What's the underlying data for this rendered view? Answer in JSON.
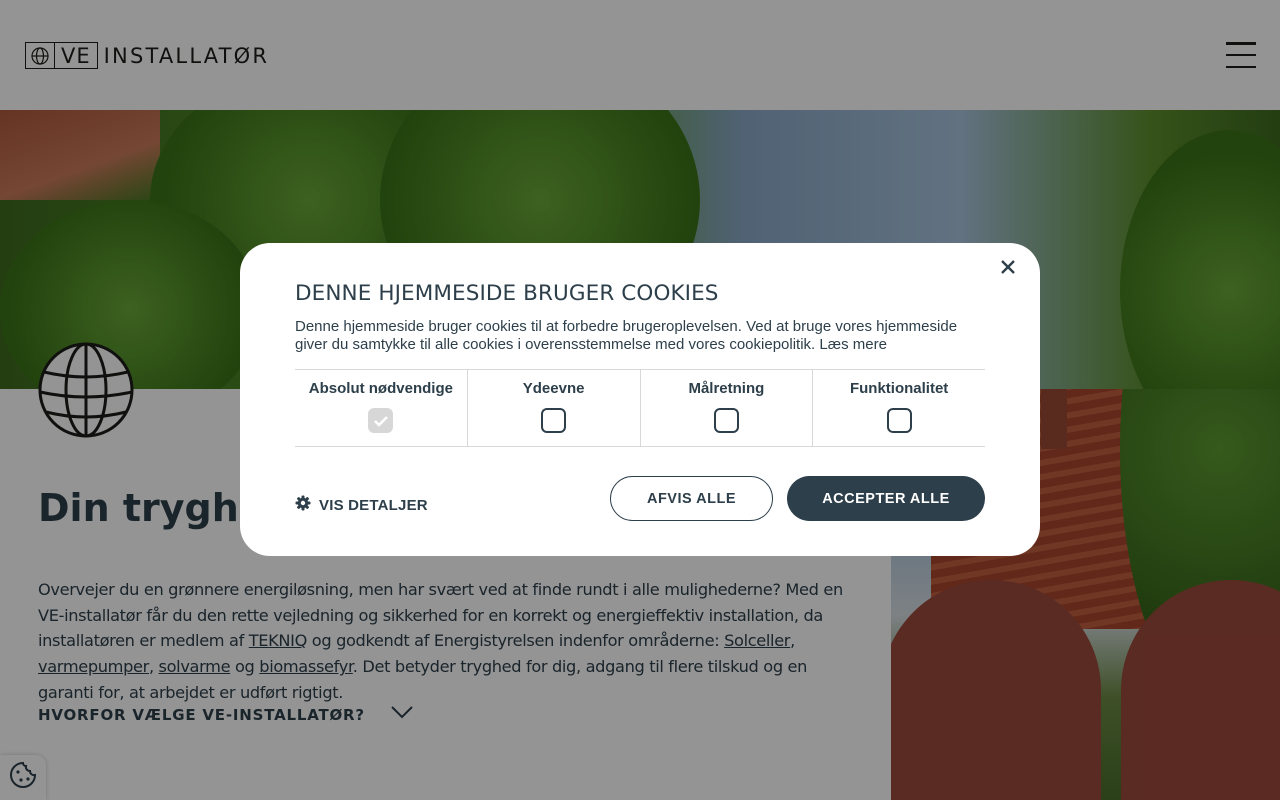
{
  "header": {
    "logo_short": "VE",
    "logo_text": "INSTALLATØR"
  },
  "main": {
    "headline": "Din tryghed",
    "intro_1": "Overvejer du en grønnere energiløsning, men har svært ved at finde rundt i alle mulighederne? Med en VE-installatør får du den rette vejledning og sikkerhed for en korrekt og energieffektiv installation, da installatøren er medlem af ",
    "link_tekniq": "TEKNIQ",
    "intro_2": " og godkendt af Energistyrelsen indenfor områderne: ",
    "link_solceller": "Solceller",
    "sep_1": ", ",
    "link_varmepumper": "varmepumper",
    "sep_2": ", ",
    "link_solvarme": "solvarme",
    "intro_3": " og ",
    "link_biomassefyr": "biomassefyr",
    "intro_4": ". Det betyder tryghed for dig, adgang til flere tilskud og en garanti for, at arbejdet er udført rigtigt.",
    "why_label": "HVORFOR VÆLGE VE-INSTALLATØR?"
  },
  "cookie_dialog": {
    "title": "DENNE HJEMMESIDE BRUGER COOKIES",
    "text": "Denne hjemmeside bruger cookies til at forbedre brugeroplevelsen. Ved at bruge vores hjemmeside giver du samtykke til alle cookies i overensstemmelse med vores cookiepolitik.",
    "read_more": "Læs mere",
    "categories": [
      {
        "label": "Absolut nødvendige",
        "checked": true,
        "disabled": true
      },
      {
        "label": "Ydeevne",
        "checked": false
      },
      {
        "label": "Målretning",
        "checked": false
      },
      {
        "label": "Funktionalitet",
        "checked": false
      }
    ],
    "details_label": "VIS DETALJER",
    "reject_label": "AFVIS ALLE",
    "accept_label": "ACCEPTER ALLE"
  },
  "colors": {
    "primary": "#2d3f4a",
    "overlay": "rgba(0,0,0,0.42)",
    "checkbox_disabled": "#d7d7d7"
  },
  "icons": {
    "menu": "hamburger-icon",
    "close": "close-icon",
    "globe": "globe-icon",
    "details": "gear-icon",
    "expand": "chevron-down-icon",
    "cookie_settings": "cookie-icon"
  }
}
